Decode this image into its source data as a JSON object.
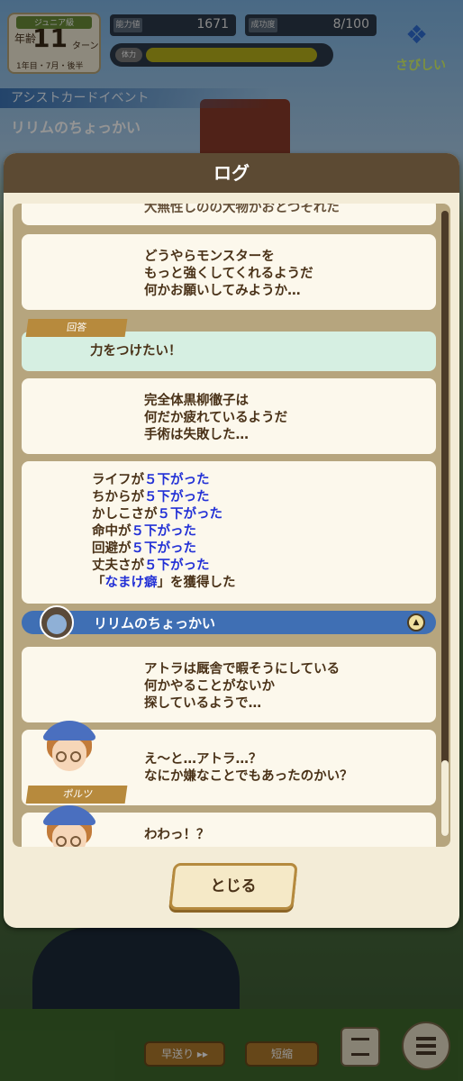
{
  "hud": {
    "rank_label": "ジュニア級",
    "age_prefix": "年齢",
    "age_value": "11",
    "stage_label": "ターン",
    "date_text": "1年目・7月・後半",
    "stat1_label": "能力値",
    "stat1_value": "1671",
    "stat2_label": "成功度",
    "stat2_value": "8/100",
    "stamina_label": "体力",
    "stamina_fraction": 0.94,
    "mood_text": "さびしい"
  },
  "event": {
    "tag": "アシストカードイベント",
    "title": "リリムのちょっかい"
  },
  "dialog": {
    "title": "ログ",
    "close_label": "とじる"
  },
  "log": {
    "partial_top": "大無性しのの大物かおとつそれた",
    "card1": [
      "どうやらモンスターを",
      "もっと強くしてくれるようだ",
      "何かお願いしてみようか…"
    ],
    "answer_tag": "回答",
    "answer_text": "力をつけたい！",
    "card2": [
      "完全体黒柳徹子は",
      "何だか疲れているようだ",
      "手術は失敗した…"
    ],
    "results": [
      {
        "pre": "ライフが",
        "val": "５下がった",
        "post": ""
      },
      {
        "pre": "ちからが",
        "val": "５下がった",
        "post": ""
      },
      {
        "pre": "かしこさが",
        "val": "５下がった",
        "post": ""
      },
      {
        "pre": "命中が",
        "val": "５下がった",
        "post": ""
      },
      {
        "pre": "回避が",
        "val": "５下がった",
        "post": ""
      },
      {
        "pre": "丈夫さが",
        "val": "５下がった",
        "post": ""
      },
      {
        "pre": "「",
        "val": "なまけ癖",
        "post": "」を獲得した"
      }
    ],
    "chapter_title": "リリムのちょっかい",
    "chapter_toggle": "▲",
    "card3": [
      "アトラは厩舎で暇そうにしている",
      "何かやることがないか",
      "探しているようで…"
    ],
    "card4_lines": [
      "え〜と…アトラ…？",
      "なにか嫌なことでもあったのかい？"
    ],
    "speaker": "ポルツ",
    "card5_line": "わわっ！？"
  },
  "bottom": {
    "fast_label": "早送り ▸▸",
    "short_label": "短縮"
  }
}
